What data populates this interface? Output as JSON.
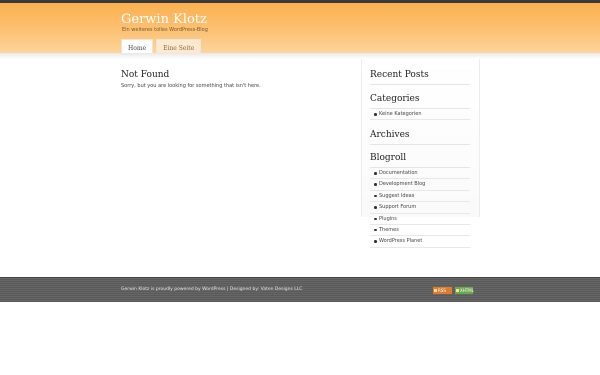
{
  "header": {
    "site_title": "Gerwin Klotz",
    "site_description": "Ein weiteres tolles WordPress-Blog"
  },
  "nav": {
    "tabs": [
      {
        "label": "Home"
      },
      {
        "label": "Eine Seite"
      }
    ]
  },
  "main": {
    "title": "Not Found",
    "text": "Sorry, but you are looking for something that isn't here."
  },
  "sidebar": {
    "recent_posts_title": "Recent Posts",
    "categories_title": "Categories",
    "categories": [
      "Keine Kategorien"
    ],
    "archives_title": "Archives",
    "blogroll_title": "Blogroll",
    "blogroll": [
      "Documentation",
      "Development Blog",
      "Suggest Ideas",
      "Support Forum",
      "Plugins",
      "Themes",
      "WordPress Planet"
    ]
  },
  "footer": {
    "text": "Gerwin Klotz is proudly powered by WordPress | Designed by: Vaten Designs LLC",
    "badge_rss": "RSS",
    "badge_xhtml": "XHTML"
  },
  "colors": {
    "header_accent": "#fbb04e",
    "footer_bg": "#5f5f5f",
    "rss_badge": "#e07a2f",
    "xhtml_badge": "#6aa84f"
  }
}
